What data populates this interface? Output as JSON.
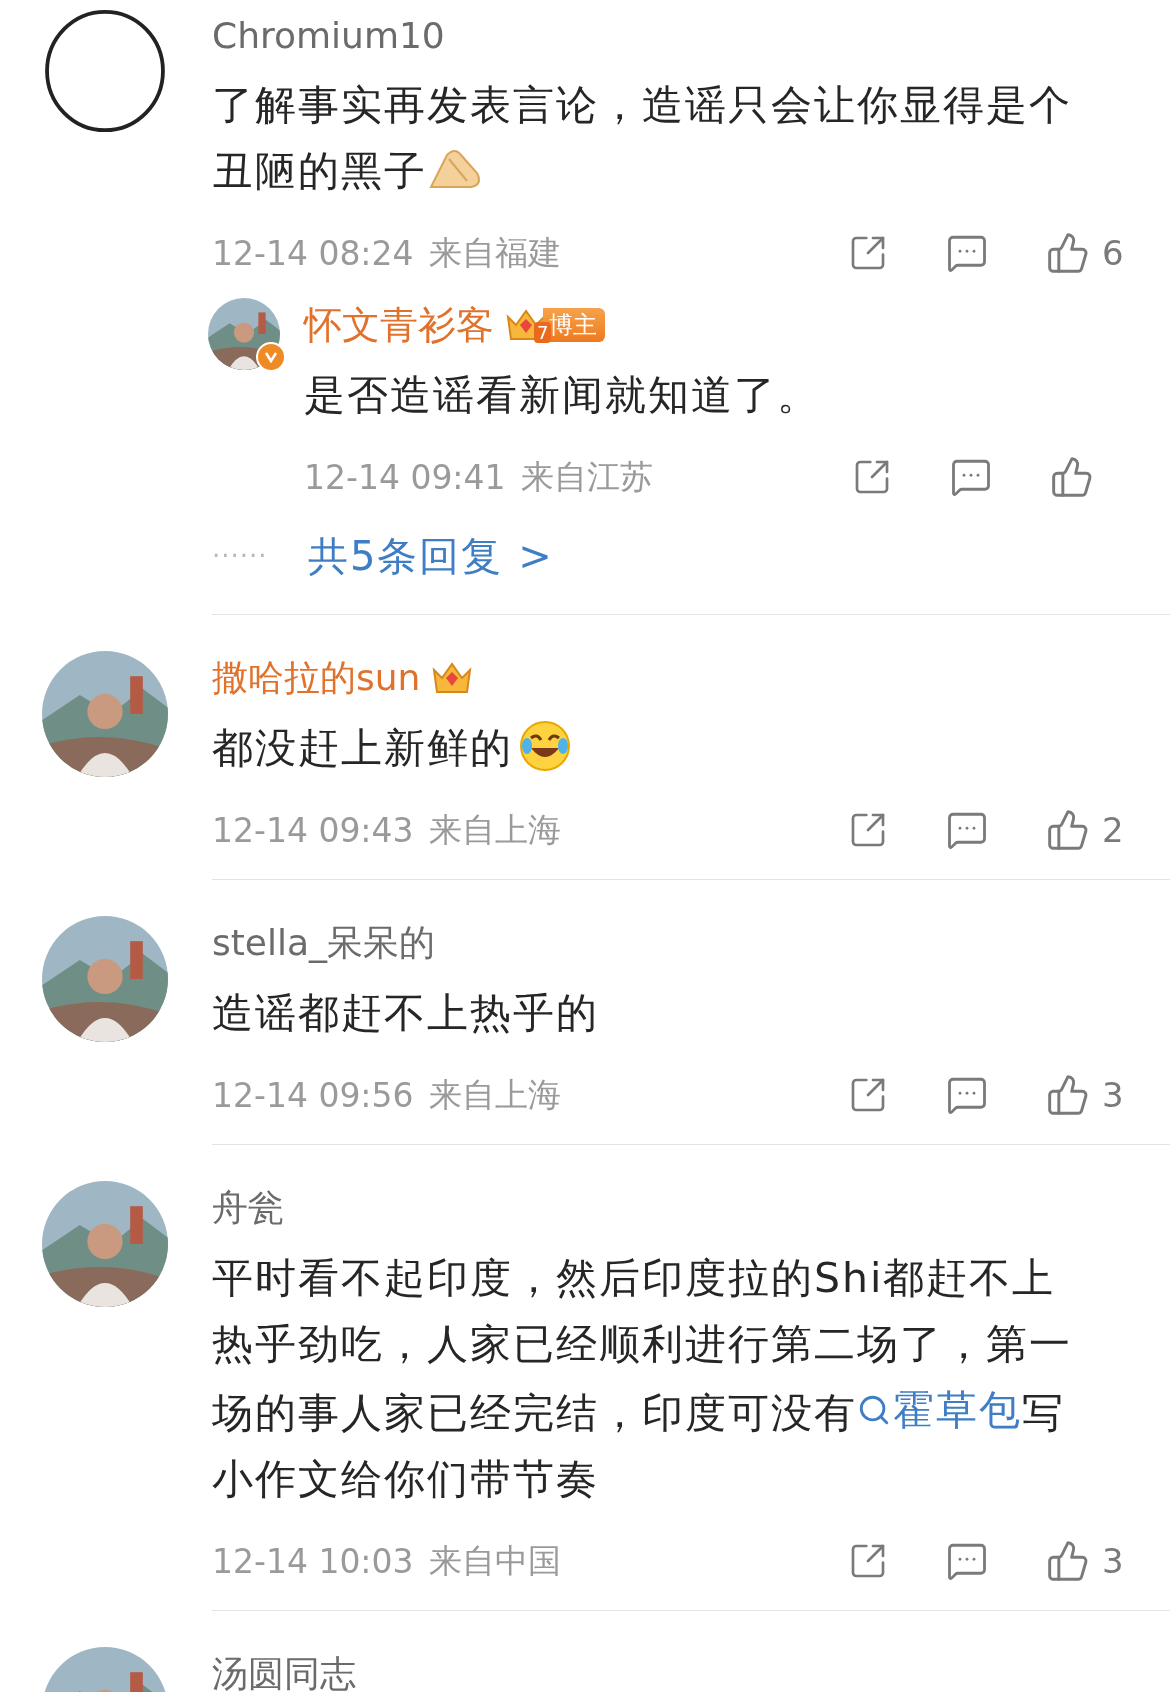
{
  "comments": [
    {
      "avatar": {
        "kind": "sketch"
      },
      "name": "Chromium10",
      "vip": false,
      "content": [
        {
          "kind": "text",
          "text": "了解事实再发表言论，造谣只会让你显得是个丑陋的黑子"
        },
        {
          "kind": "praise"
        }
      ],
      "time": "12-14 08:24",
      "location": "来自福建",
      "likes": "6",
      "reply": {
        "avatar": {
          "kind": "picture"
        },
        "verified": true,
        "name": "怀文青衫客",
        "vip": true,
        "badge_level": "7",
        "badge_label": "博主",
        "content": [
          {
            "kind": "text",
            "text": "是否造谣看新闻就知道了。"
          }
        ],
        "time": "12-14 09:41",
        "location": "来自江苏"
      },
      "more": {
        "dots": "······",
        "label": "共5条回复 >"
      }
    },
    {
      "avatar": {
        "kind": "picture"
      },
      "name": "撒哈拉的sun",
      "vip": true,
      "content": [
        {
          "kind": "text",
          "text": "都没赶上新鲜的"
        },
        {
          "kind": "laugh"
        }
      ],
      "time": "12-14 09:43",
      "location": "来自上海",
      "likes": "2"
    },
    {
      "avatar": {
        "kind": "picture"
      },
      "name": "stella_呆呆的",
      "vip": false,
      "content": [
        {
          "kind": "text",
          "text": "造谣都赶不上热乎的"
        }
      ],
      "time": "12-14 09:56",
      "location": "来自上海",
      "likes": "3"
    },
    {
      "avatar": {
        "kind": "picture"
      },
      "name": "舟瓮",
      "vip": false,
      "content": [
        {
          "kind": "text",
          "text": "平时看不起印度，然后印度拉的Shi都赶不上热乎劲吃，人家已经顺利进行第二场了，第一场的事人家已经完结，印度可没有"
        },
        {
          "kind": "link",
          "text": "霍草包"
        },
        {
          "kind": "text",
          "text": "写小作文给你们带节奏"
        }
      ],
      "time": "12-14 10:03",
      "location": "来自中国",
      "likes": "3"
    },
    {
      "avatar": {
        "kind": "picture"
      },
      "name": "汤圆同志",
      "vip": false
    }
  ]
}
